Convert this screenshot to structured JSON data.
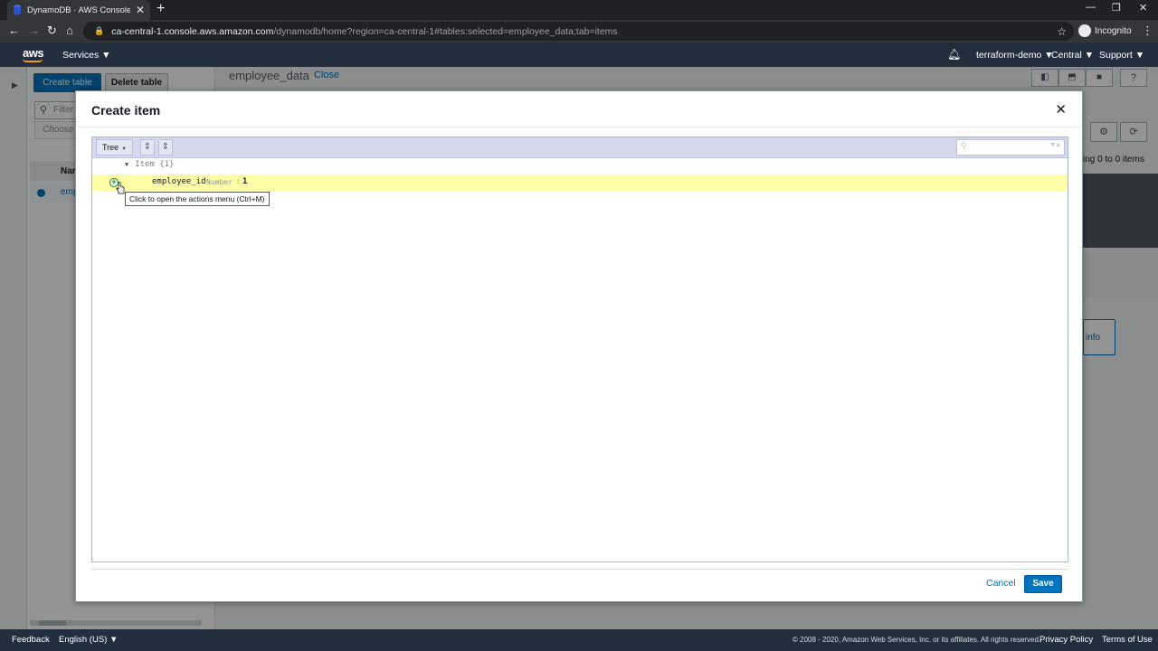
{
  "browser": {
    "tab_title": "DynamoDB · AWS Console",
    "tab_close": "✕",
    "new_tab": "+",
    "url_host": "ca-central-1.console.aws.amazon.com",
    "url_path": "/dynamodb/home?region=ca-central-1#tables:selected=employee_data;tab=items",
    "incognito_label": "Incognito"
  },
  "aws_nav": {
    "logo": "aws",
    "services": "Services ▼",
    "account": "terraform-demo ▼",
    "region": "Central ▼",
    "support": "Support ▼"
  },
  "left_panel": {
    "create_table": "Create table",
    "delete_table": "Delete table",
    "filter_placeholder": "Filter",
    "choose_placeholder": "Choose",
    "column_name": "Nar",
    "row_name": "emp"
  },
  "main": {
    "table_title": "employee_data",
    "close_link": "Close",
    "items_count": "ing 0 to 0 items",
    "info_label": "info"
  },
  "modal": {
    "title": "Create item",
    "close": "✕",
    "editor": {
      "mode": "Tree",
      "root_label": "Item {1}",
      "field": {
        "name": "employee_id",
        "type": "Number",
        "separator": ":",
        "value": "1"
      },
      "tooltip": "Click to open the actions menu (Ctrl+M)"
    },
    "cancel": "Cancel",
    "save": "Save"
  },
  "footer": {
    "feedback": "Feedback",
    "language": "English (US) ▼",
    "copyright": "© 2008 - 2020, Amazon Web Services, Inc. or its affiliates. All rights reserved.",
    "privacy": "Privacy Policy",
    "terms": "Terms of Use"
  },
  "colors": {
    "aws_nav": "#232f3e",
    "primary_button": "#0073bb",
    "editor_bar": "#d5d9ee",
    "highlight_row": "#ffffa8"
  }
}
